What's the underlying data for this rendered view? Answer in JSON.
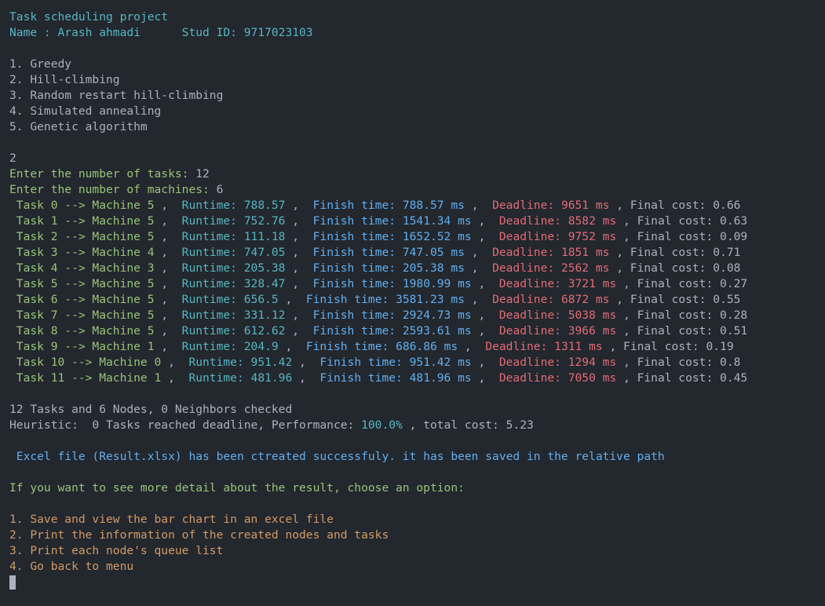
{
  "header": {
    "title": "Task scheduling project",
    "name_label": "Name : Arash ahmadi",
    "stud_id_label": "Stud ID: 9717023103"
  },
  "menu": [
    "1. Greedy",
    "2. Hill-climbing",
    "3. Random restart hill-climbing",
    "4. Simulated annealing",
    "5. Genetic algorithm"
  ],
  "selected_option": "2",
  "prompts": {
    "tasks_label": "Enter the number of tasks: ",
    "tasks_value": "12",
    "machines_label": "Enter the number of machines: ",
    "machines_value": "6"
  },
  "tasks": [
    {
      "task": "0",
      "machine": "5",
      "runtime": "788.57",
      "finish": "788.57",
      "deadline": "9651",
      "cost": "0.66"
    },
    {
      "task": "1",
      "machine": "5",
      "runtime": "752.76",
      "finish": "1541.34",
      "deadline": "8582",
      "cost": "0.63"
    },
    {
      "task": "2",
      "machine": "5",
      "runtime": "111.18",
      "finish": "1652.52",
      "deadline": "9752",
      "cost": "0.09"
    },
    {
      "task": "3",
      "machine": "4",
      "runtime": "747.05",
      "finish": "747.05",
      "deadline": "1851",
      "cost": "0.71"
    },
    {
      "task": "4",
      "machine": "3",
      "runtime": "205.38",
      "finish": "205.38",
      "deadline": "2562",
      "cost": "0.08"
    },
    {
      "task": "5",
      "machine": "5",
      "runtime": "328.47",
      "finish": "1980.99",
      "deadline": "3721",
      "cost": "0.27"
    },
    {
      "task": "6",
      "machine": "5",
      "runtime": "656.5",
      "finish": "3581.23",
      "deadline": "6872",
      "cost": "0.55"
    },
    {
      "task": "7",
      "machine": "5",
      "runtime": "331.12",
      "finish": "2924.73",
      "deadline": "5038",
      "cost": "0.28"
    },
    {
      "task": "8",
      "machine": "5",
      "runtime": "612.62",
      "finish": "2593.61",
      "deadline": "3966",
      "cost": "0.51"
    },
    {
      "task": "9",
      "machine": "1",
      "runtime": "204.9",
      "finish": "686.86",
      "deadline": "1311",
      "cost": "0.19"
    },
    {
      "task": "10",
      "machine": "0",
      "runtime": "951.42",
      "finish": "951.42",
      "deadline": "1294",
      "cost": "0.8"
    },
    {
      "task": "11",
      "machine": "1",
      "runtime": "481.96",
      "finish": "481.96",
      "deadline": "7050",
      "cost": "0.45"
    }
  ],
  "summary": {
    "line1": "12 Tasks and 6 Nodes, 0 Neighbors checked",
    "line2_prefix": "Heuristic:  0 Tasks reached deadline, Performance: ",
    "performance": "100.0%",
    "line2_suffix": " , total cost: 5.23"
  },
  "excel_message": " Excel file (Result.xlsx) has been ctreated successfuly. it has been saved in the relative path",
  "detail_prompt": "If you want to see more detail about the result, choose an option:",
  "detail_options": [
    "1. Save and view the bar chart in an excel file",
    "2. Print the information of the created nodes and tasks",
    "3. Print each node's queue list",
    "4. Go back to menu"
  ],
  "colors": {
    "background": "#23272e",
    "green": "#98c379",
    "cyan": "#56b6c2",
    "blue": "#61afef",
    "red": "#e06c75",
    "orange": "#d19a66"
  }
}
